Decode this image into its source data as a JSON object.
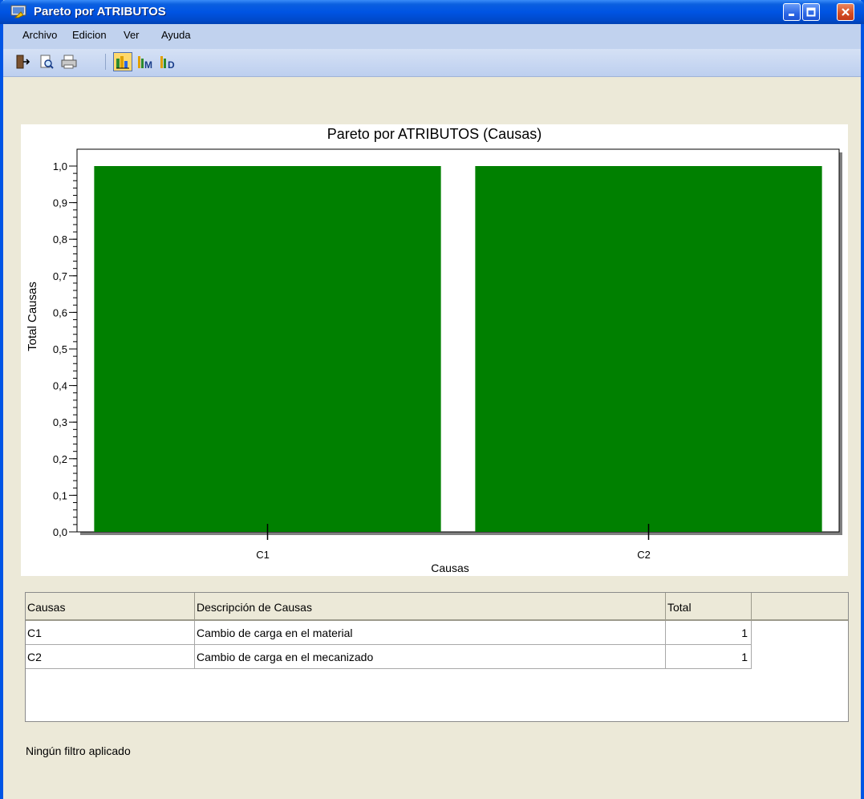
{
  "window": {
    "title": "Pareto por ATRIBUTOS"
  },
  "menu": {
    "items": [
      "Archivo",
      "Edicion",
      "Ver",
      "Ayuda"
    ]
  },
  "toolbar": {
    "buttons": [
      "exit-icon",
      "print-preview-icon",
      "print-icon",
      "chart-icon",
      "chart-m-icon",
      "chart-d-icon"
    ]
  },
  "chart_data": {
    "type": "bar",
    "title": "Pareto por ATRIBUTOS (Causas)",
    "xlabel": "Causas",
    "ylabel": "Total Causas",
    "categories": [
      "C1",
      "C2"
    ],
    "values": [
      1,
      1
    ],
    "ylim": [
      0,
      1.0
    ],
    "yticks": [
      "0,0",
      "0,1",
      "0,2",
      "0,3",
      "0,4",
      "0,5",
      "0,6",
      "0,7",
      "0,8",
      "0,9",
      "1,0"
    ],
    "bar_color": "#008000",
    "grid": false
  },
  "table": {
    "columns": [
      "Causas",
      "Descripción de Causas",
      "Total"
    ],
    "rows": [
      [
        "C1",
        "Cambio de carga en el material",
        "1"
      ],
      [
        "C2",
        "Cambio de carga en el mecanizado",
        "1"
      ]
    ]
  },
  "status": {
    "text": "Ningún filtro aplicado"
  }
}
